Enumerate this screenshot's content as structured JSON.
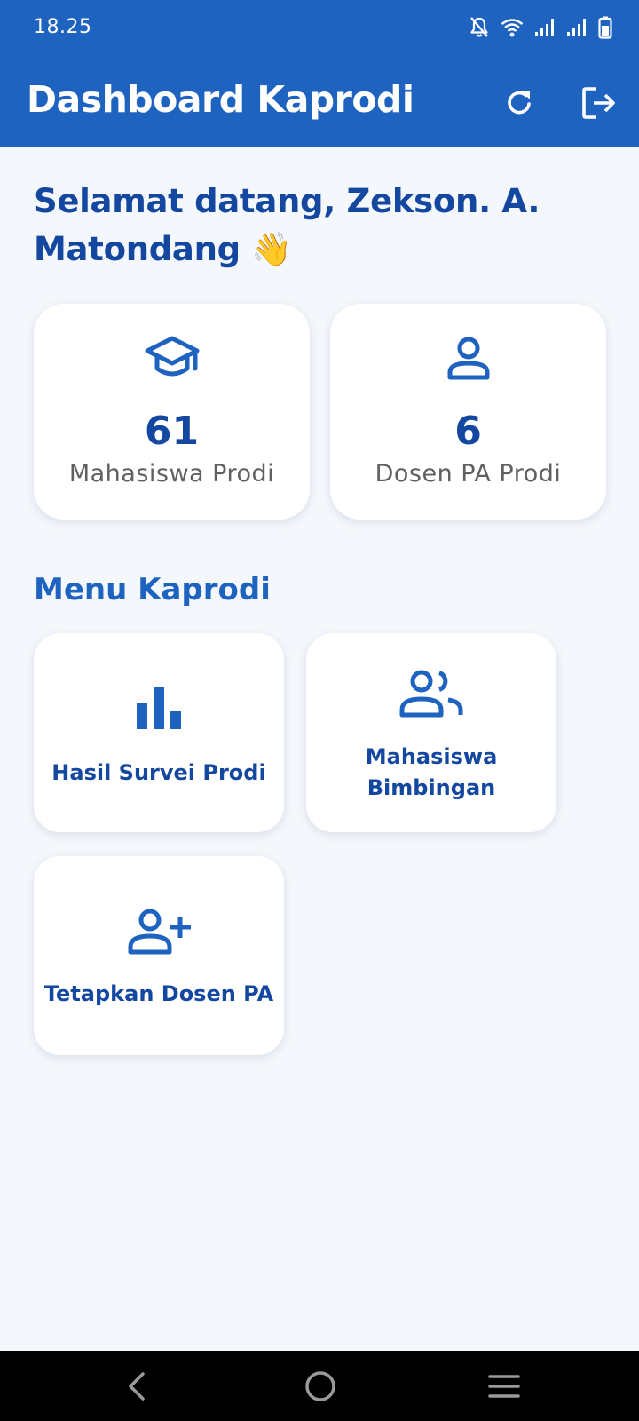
{
  "status_bar": {
    "time": "18.25",
    "icons": [
      "notifications-off-icon",
      "wifi-icon",
      "signal-icon",
      "signal-icon",
      "battery-icon"
    ]
  },
  "app_bar": {
    "title": "Dashboard Kaprodi",
    "actions": [
      "refresh-icon",
      "logout-icon"
    ]
  },
  "welcome": {
    "text": "Selamat datang, Zekson. A. Matondang 👋"
  },
  "stats": [
    {
      "icon": "graduation-cap-icon",
      "value": "61",
      "label": "Mahasiswa Prodi"
    },
    {
      "icon": "person-icon",
      "value": "6",
      "label": "Dosen PA Prodi"
    }
  ],
  "menu": {
    "title": "Menu Kaprodi",
    "items": [
      {
        "icon": "bar-chart-icon",
        "label": "Hasil Survei Prodi"
      },
      {
        "icon": "group-icon",
        "label": "Mahasiswa Bimbingan"
      },
      {
        "icon": "person-add-icon",
        "label": "Tetapkan Dosen PA"
      }
    ]
  },
  "nav_bar": {
    "buttons": [
      "back-icon",
      "home-icon",
      "menu-icon"
    ]
  },
  "colors": {
    "primary": "#1e63c0",
    "primary_dark": "#1347a0",
    "background": "#f4f7fb",
    "card": "#ffffff",
    "muted_text": "#606060",
    "nav_bar": "#000000"
  }
}
